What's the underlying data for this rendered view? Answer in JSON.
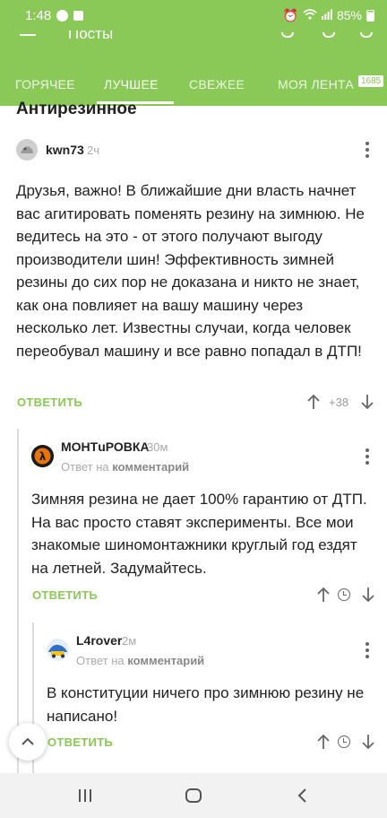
{
  "status_bar": {
    "time": "1:48",
    "battery": "85%"
  },
  "header": {
    "title": "Посты",
    "tabs": [
      {
        "label": "ГОРЯЧЕЕ"
      },
      {
        "label": "ЛУЧШЕЕ"
      },
      {
        "label": "СВЕЖЕЕ"
      },
      {
        "label": "МОЯ ЛЕНТА"
      }
    ],
    "feed_count": "1685",
    "active_tab_index": 1
  },
  "post": {
    "title": "Антирезинное"
  },
  "comments": [
    {
      "author": "kwn73",
      "time": "2ч",
      "text": "Друзья, важно! В ближайшие дни власть начнет вас агитировать поменять резину на зимнюю. Не ведитесь на это - от этого получают выгоду производители шин! Эффективность зимней резины до сих пор не доказана и никто не знает, как она повлияет на вашу машину через несколько лет. Известны случаи, когда человек переобувал машину и все равно попадал в ДТП!",
      "reply_label": "ОТВЕТИТЬ",
      "score": "+38"
    },
    {
      "author": "МОНТuРОВКА",
      "time": "30м",
      "reply_to_prefix": "Ответ на",
      "reply_to_target": "комментарий",
      "text": "Зимняя резина не дает 100% гарантию от ДТП. На вас просто ставят эксперименты. Все мои знакомые шиномонтажники круглый год ездят на летней. Задумайтесь.",
      "reply_label": "ОТВЕТИТЬ"
    },
    {
      "author": "L4rover",
      "time": "2м",
      "reply_to_prefix": "Ответ на",
      "reply_to_target": "комментарий",
      "text": "В конституции ничего про зимнюю резину не написано!",
      "reply_label": "ОТВЕТИТЬ"
    }
  ],
  "colors": {
    "accent": "#8ac858"
  }
}
